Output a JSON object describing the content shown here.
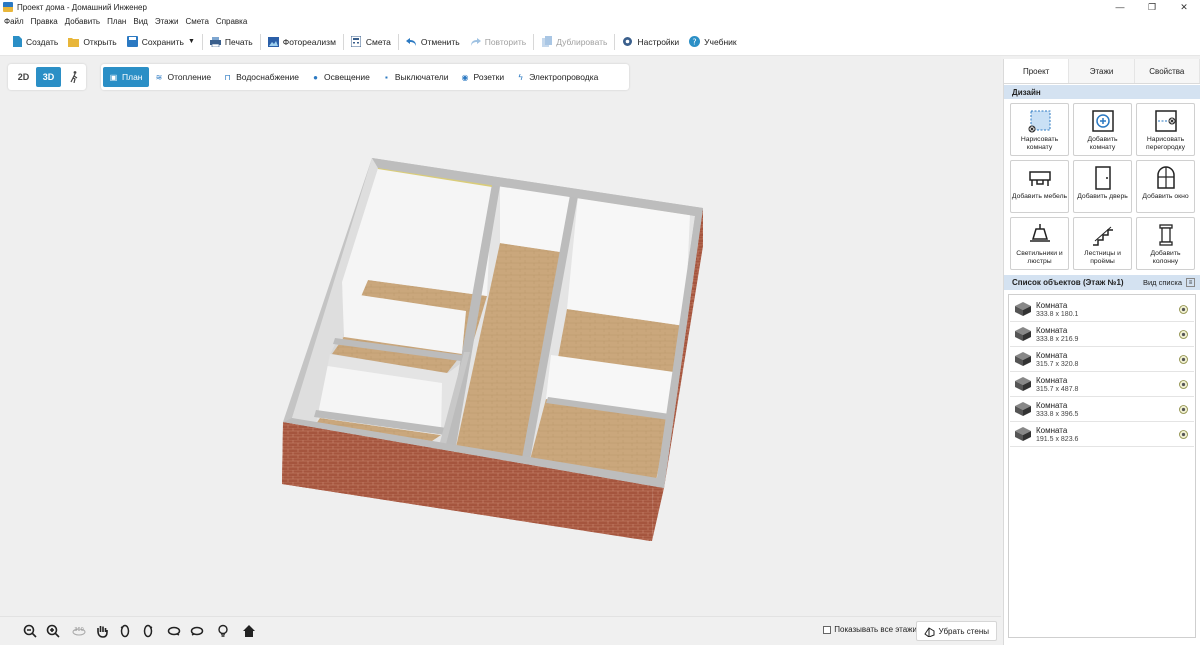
{
  "window": {
    "title": "Проект дома - Домашний Инженер",
    "controls": [
      "—",
      "❐",
      "✕"
    ]
  },
  "menu": [
    "Файл",
    "Правка",
    "Добавить",
    "План",
    "Вид",
    "Этажи",
    "Смета",
    "Справка"
  ],
  "toolbar": {
    "create": "Создать",
    "open": "Открыть",
    "save": "Сохранить",
    "print": "Печать",
    "photorealism": "Фотореализм",
    "estimate": "Смета",
    "undo": "Отменить",
    "redo": "Повторить",
    "duplicate": "Дублировать",
    "settings": "Настройки",
    "tutorial": "Учебник"
  },
  "view_modes": {
    "mode_2d": "2D",
    "mode_3d": "3D",
    "active": "3D"
  },
  "layers": {
    "plan": "План",
    "heating": "Отопление",
    "water": "Водоснабжение",
    "lighting": "Освещение",
    "switches": "Выключатели",
    "sockets": "Розетки",
    "wiring": "Электропроводка",
    "active": "План"
  },
  "bottom": {
    "show_all_floors": "Показывать все этажи",
    "show_all_floors_checked": false,
    "hide_walls": "Убрать стены"
  },
  "panel": {
    "tabs": {
      "project": "Проект",
      "floors": "Этажи",
      "properties": "Свойства"
    },
    "active_tab": "Проект",
    "design_title": "Дизайн",
    "design_buttons": {
      "draw_room": "Нарисовать комнату",
      "add_room": "Добавить комнату",
      "draw_partition": "Нарисовать перегородку",
      "add_furniture": "Добавить мебель",
      "add_door": "Добавить дверь",
      "add_window": "Добавить окно",
      "lamps": "Светильники и люстры",
      "stairs": "Лестницы и проёмы",
      "add_column": "Добавить колонну"
    },
    "list_title": "Список объектов (Этаж №1)",
    "list_view": "Вид списка",
    "objects": [
      {
        "name": "Комната",
        "size": "333.8 x 180.1"
      },
      {
        "name": "Комната",
        "size": "333.8 x 216.9"
      },
      {
        "name": "Комната",
        "size": "315.7 x 320.8"
      },
      {
        "name": "Комната",
        "size": "315.7 x 487.8"
      },
      {
        "name": "Комната",
        "size": "333.8 x 396.5"
      },
      {
        "name": "Комната",
        "size": "191.5 x 823.6"
      }
    ]
  },
  "colors": {
    "accent": "#2b8fc6",
    "section_header": "#d4e2f1",
    "brick": "#a5553e",
    "floor_wood": "#caa77c",
    "wall_top": "#b9b9b9"
  }
}
